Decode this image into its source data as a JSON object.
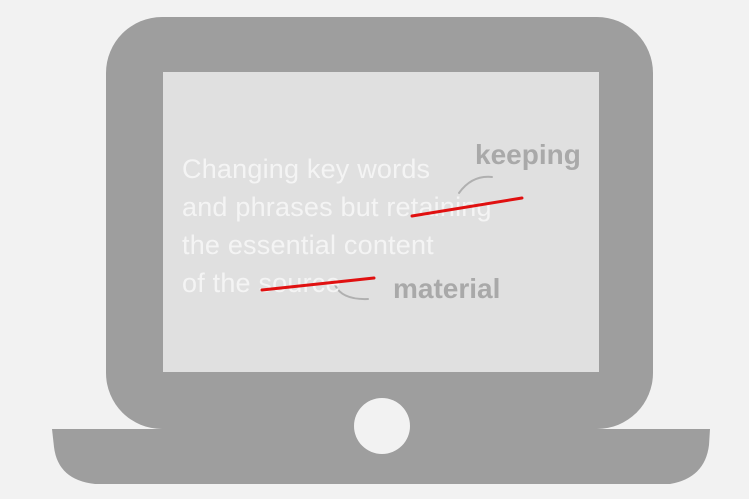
{
  "colors": {
    "background": "#f2f2f2",
    "device_body": "#9e9e9e",
    "screen": "#e0e0e0",
    "text": "#f4f4f4",
    "replacement_text": "#a9a9a9",
    "strike": "#e01010",
    "home_button": "#f2f2f2"
  },
  "icons": {
    "device": "laptop-icon",
    "strikethrough": "strikethrough-line-icon",
    "arrow": "curved-arrow-icon"
  },
  "sentence": {
    "line_1": "Changing key words",
    "line_2_before": "and phrases but ",
    "line_2_struck": "retaining",
    "line_3": "the essential content",
    "line_4_before": "of the ",
    "line_4_struck": "source"
  },
  "replacements": {
    "first": "keeping",
    "second": "material"
  }
}
